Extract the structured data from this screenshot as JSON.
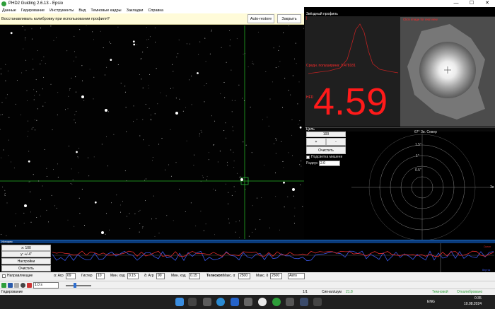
{
  "window": {
    "title": "PHD2 Guiding 2.6.13 - Epsio",
    "minimize": "—",
    "maximize": "☐",
    "close": "✕"
  },
  "menu": [
    "Данные",
    "Гидирование",
    "Инструменты",
    "Вид",
    "Темновые кадры",
    "Закладки",
    "Справка"
  ],
  "notice": {
    "message": "Восстанавливать калибровку при использовании профиля?",
    "auto_restore": "Auto-restore",
    "close": "Закрыть"
  },
  "profile": {
    "header": "Звёздный профиль",
    "overlay_text": "Click image for real view",
    "hfd_label": "HFD",
    "fwhm_label": "Средн. полуширина: 3.478181",
    "hfd_value": "4.59"
  },
  "target": {
    "header": "Цель",
    "scale_value": "100",
    "plus": "+",
    "minus": "-",
    "clear": "Очистить",
    "highlight_label": "Подсветка мишени",
    "radius_label": "Радиус",
    "radius_value": "2.0",
    "angle_label": "67° Зв. Север",
    "rings": [
      "1.5\"",
      "1\"",
      "0.5\""
    ],
    "east_label": "Зв"
  },
  "history": {
    "header": "История",
    "x_scale": "x: 100",
    "y_scale": "y: +/-4\"",
    "settings": "Настройки",
    "clear": "Очистить",
    "ra_legend": "Склон",
    "dec_legend": "Вертик",
    "direction_label": "Направляющие",
    "corrections_label": "Коррекции"
  },
  "controls": {
    "ra_label": "α: Агр",
    "ra_aggr": "69",
    "hyst_label": "Гистер",
    "hyst": "10",
    "min_move_label": "Мин. ход",
    "ra_min_move": "0.15",
    "dec_label": "δ: Агр",
    "dec_aggr": "90",
    "dec_min_move_label": "Мин. ход",
    "dec_min_move": "0.15",
    "scope_label": "Телескоп:",
    "max_ra_label": "Макс. α",
    "max_ra": "2500",
    "max_dec_label": "Макс. δ",
    "max_dec": "2500",
    "mode": "Авто"
  },
  "toolbar": {
    "exposure": "1.0 s"
  },
  "status": {
    "state": "Гидирование",
    "frame": "1/1",
    "snr_label": "Сигнал/шум",
    "snr_value": "21.8",
    "dark": "Темновой",
    "calibrated": "Откалибровано"
  },
  "taskbar": {
    "lang": "ENG",
    "time": "0:35",
    "date": "10.08.2024"
  },
  "colors": {
    "ra_line": "#3a57e8",
    "dec_line": "#e22a2a",
    "guide_green": "#1c6b1c",
    "hfd_red": "#ff1a1a"
  }
}
